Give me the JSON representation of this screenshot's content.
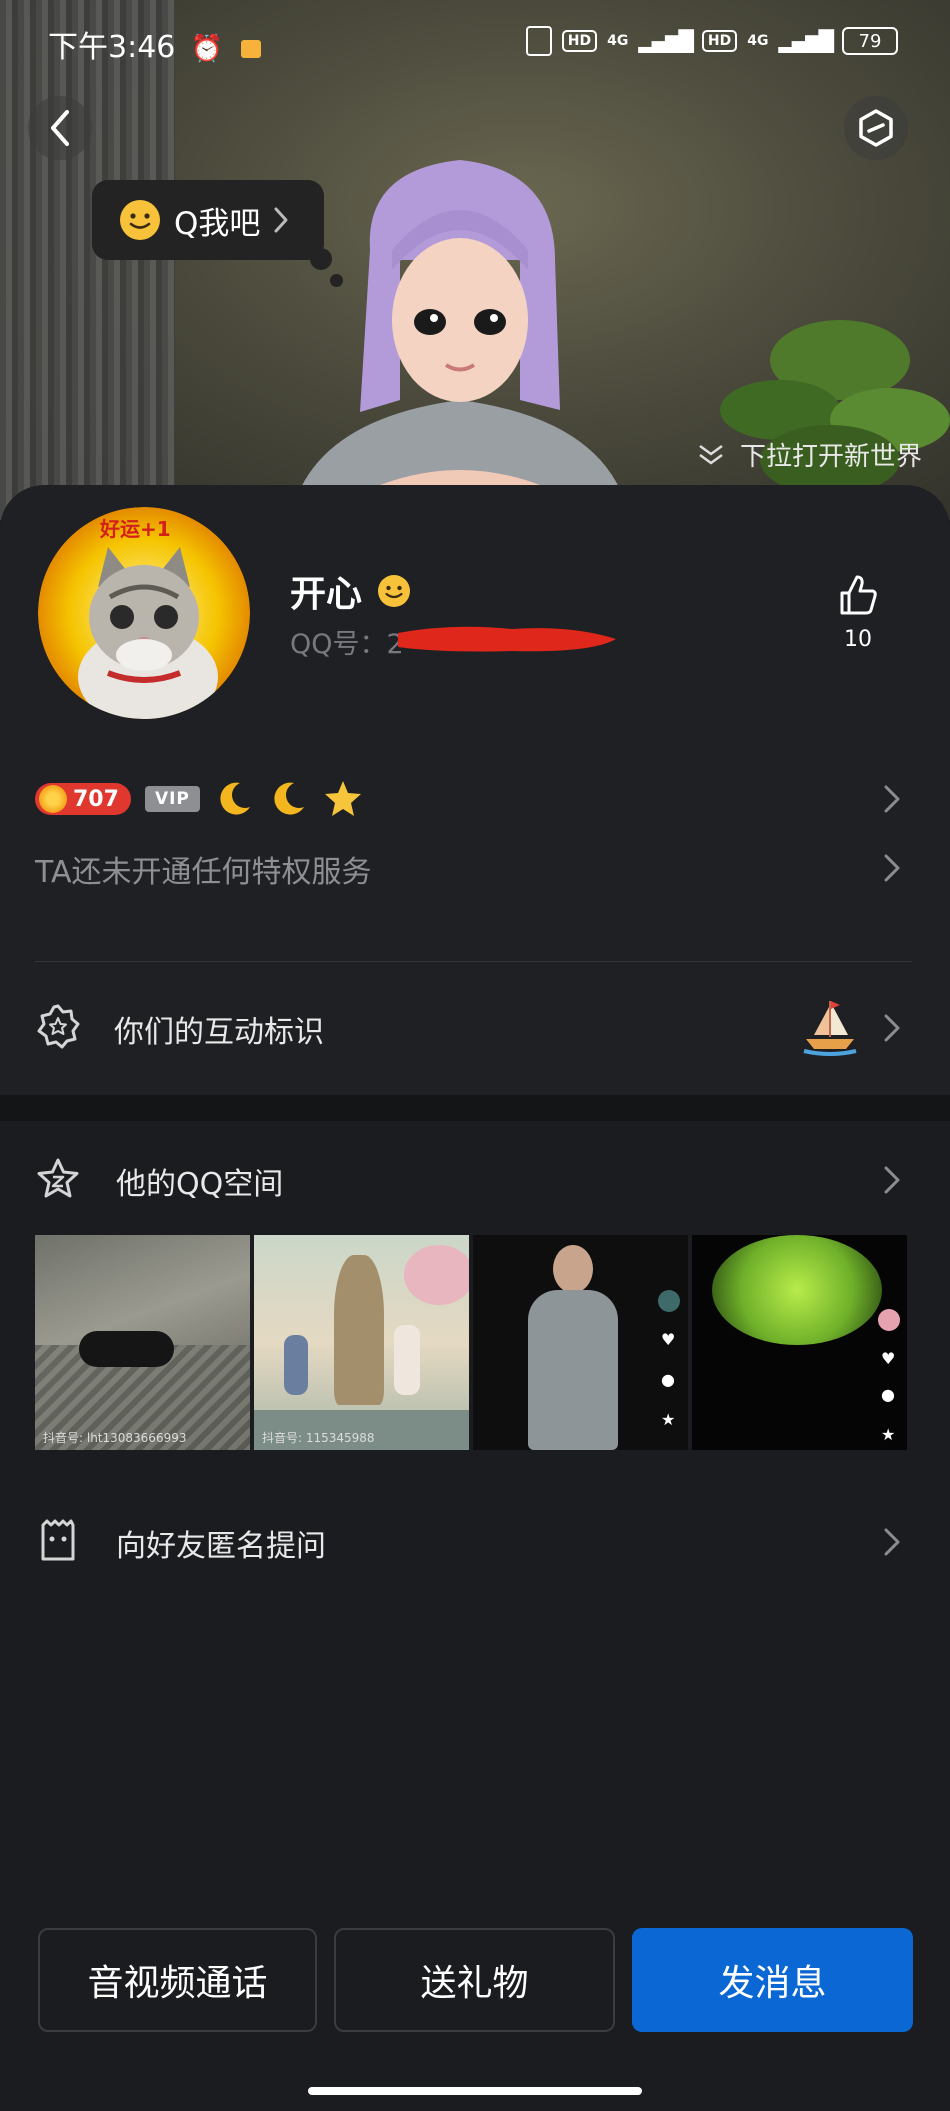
{
  "status_bar": {
    "time": "下午3:46",
    "hd1": "HD",
    "net1": "4G",
    "hd2": "HD",
    "net2": "4G",
    "battery": "79"
  },
  "hero": {
    "q_bubble_label": "Q我吧",
    "pull_hint": "下拉打开新世界"
  },
  "profile": {
    "name": "开心",
    "qq_label": "QQ号：2",
    "likes": "10",
    "avatar_text": "好运+1"
  },
  "badges": {
    "level": "707",
    "vip": "VIP"
  },
  "rows": {
    "privilege": "TA还未开通任何特权服务",
    "interaction": "你们的互动标识",
    "qzone": "他的QQ空间",
    "anon_question": "向好友匿名提问"
  },
  "thumbs": [
    {
      "caption": "抖音号: lht13083666993"
    },
    {
      "caption": "抖音号: 115345988"
    },
    {
      "caption": ""
    },
    {
      "caption": ""
    }
  ],
  "bottom_buttons": {
    "call": "音视频通话",
    "gift": "送礼物",
    "message": "发消息"
  },
  "colors": {
    "primary": "#0a67d4",
    "background": "#1b1c1f",
    "card": "#1f2023",
    "level_badge": "#e0372f"
  }
}
